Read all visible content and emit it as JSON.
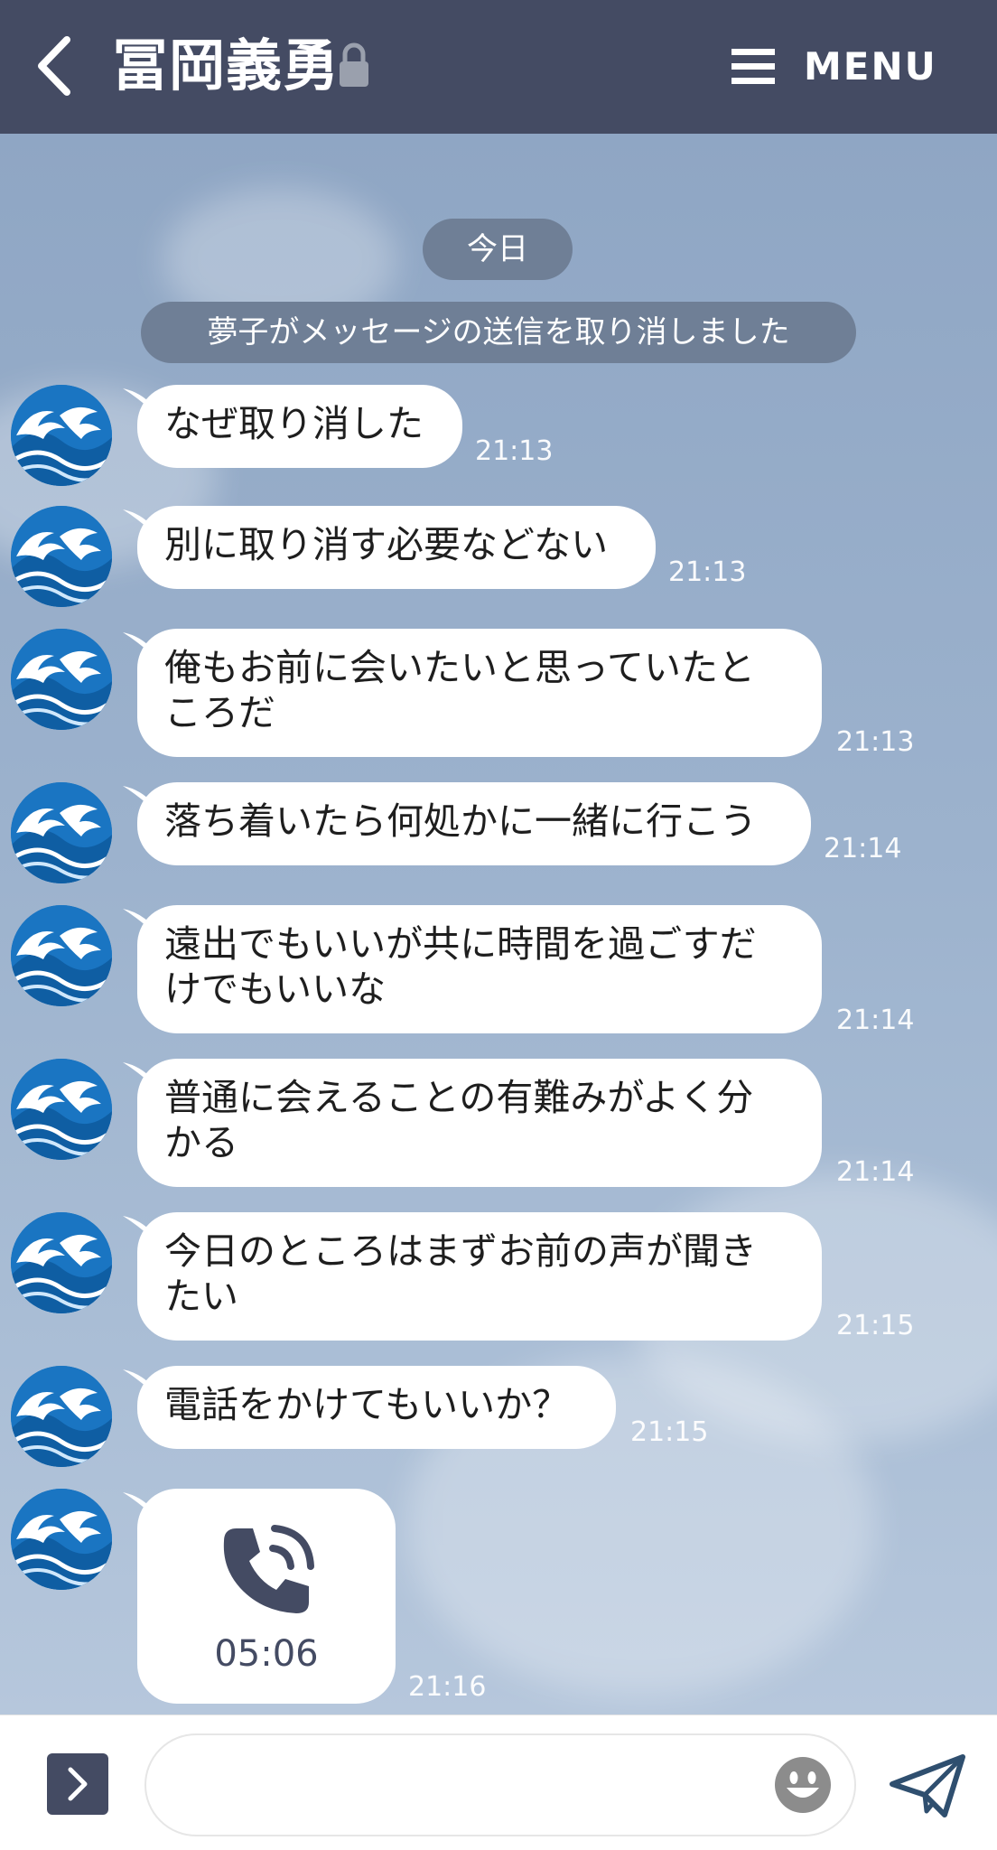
{
  "header": {
    "title": "冨岡義勇",
    "menu_label": "MENU",
    "background": "#444b63"
  },
  "chat": {
    "date_label": "今日",
    "notice": "夢子がメッセージの送信を取り消しました",
    "messages": [
      {
        "text": "なぜ取り消した",
        "time": "21:13"
      },
      {
        "text": "別に取り消す必要などない",
        "time": "21:13"
      },
      {
        "text": "俺もお前に会いたいと思っていたと\nころだ",
        "time": "21:13"
      },
      {
        "text": "落ち着いたら何処かに一緒に行こう",
        "time": "21:14"
      },
      {
        "text": "遠出でもいいが共に時間を過ごすだ\nけでもいいな",
        "time": "21:14"
      },
      {
        "text": "普通に会えることの有難みがよく分\nかる",
        "time": "21:14"
      },
      {
        "text": "今日のところはまずお前の声が聞き\nたい",
        "time": "21:15"
      },
      {
        "text": "電話をかけてもいいか？",
        "time": "21:15"
      }
    ],
    "call": {
      "duration": "05:06",
      "time": "21:16",
      "icon": "phone-call-icon"
    }
  },
  "input": {
    "placeholder": "",
    "icons": {
      "expand": "chevron-right-icon",
      "emoji": "smiley-icon",
      "send": "paper-plane-icon"
    }
  }
}
